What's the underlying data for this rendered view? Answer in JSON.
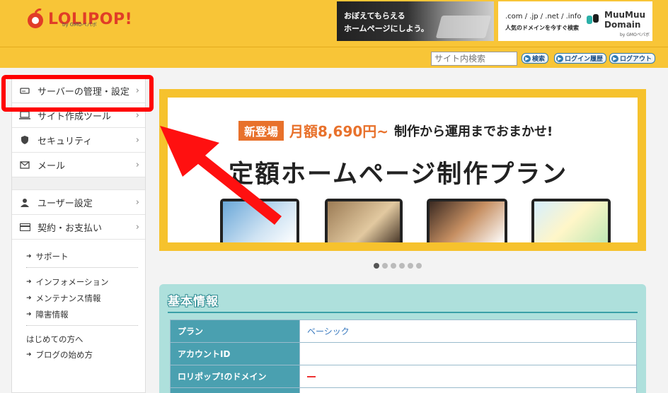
{
  "header": {
    "logo_text": "LOLIPOP!",
    "logo_sub": "by GMOペパボ",
    "ad_left": {
      "line1": "おぼえてもらえる",
      "line2": "ホームページにしよう。"
    },
    "ad_right": {
      "domains": ".com / .jp / .net / .info",
      "tagline": "人気のドメインを今すぐ検索",
      "brand_line1": "MuuMuu",
      "brand_line2": "Domain",
      "brand_sub": "by GMOペパボ"
    }
  },
  "toolbar": {
    "search_placeholder": "サイト内検索",
    "search_button": "検索",
    "login_history": "ログイン履歴",
    "logout": "ログアウト"
  },
  "sidebar": {
    "items": [
      {
        "label": "サーバーの管理・設定",
        "icon": "server-icon"
      },
      {
        "label": "サイト作成ツール",
        "icon": "laptop-icon"
      },
      {
        "label": "セキュリティ",
        "icon": "shield-icon"
      },
      {
        "label": "メール",
        "icon": "mail-icon"
      }
    ],
    "items2": [
      {
        "label": "ユーザー設定",
        "icon": "user-icon"
      },
      {
        "label": "契約・お支払い",
        "icon": "credit-card-icon"
      }
    ],
    "links": [
      "サポート",
      "インフォメーション",
      "メンテナンス情報",
      "障害情報"
    ],
    "plain": [
      "はじめての方へ"
    ],
    "more_links": [
      "ブログの始め方"
    ]
  },
  "banner": {
    "tag": "新登場",
    "price": "月額8,690円~",
    "catch": "制作から運用までおまかせ!",
    "title": "定額ホームページ制作プラン"
  },
  "carousel": {
    "count": 6,
    "active": 0
  },
  "info": {
    "title": "基本情報",
    "rows": [
      {
        "key": "プラン",
        "value": "ベーシック"
      },
      {
        "key": "アカウントID",
        "value": ""
      },
      {
        "key": "ロリポップ!のドメイン",
        "value": ""
      },
      {
        "key": "",
        "value": ""
      }
    ]
  },
  "colors": {
    "header": "#f8c537",
    "accent_red": "#ff0000",
    "teal": "#4aa0b0"
  }
}
